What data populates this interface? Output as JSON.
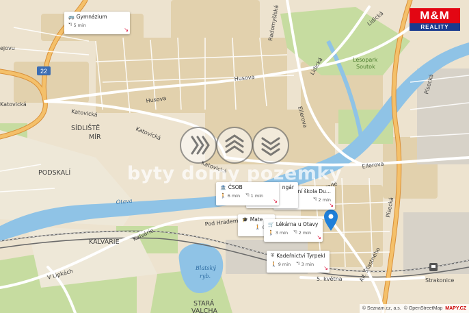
{
  "streets": {
    "radomyslska": "Radomyšlská",
    "lidicka": "Lidická",
    "husova": "Husova",
    "katovicka1": "Katovická",
    "katovicka2": "Katovická",
    "katovicka3": "Katovická",
    "katovicka4": "Katovická",
    "ellerova1": "Ellerova",
    "ellerova2": "Ellerova",
    "piseka1": "Písecká",
    "piseka2": "Písecká",
    "podhradem": "Pod Hradem",
    "kalvarie": "Kalvárie",
    "vlipkach": "V Lipkách",
    "kvetna": "5. května",
    "strasneho": "Alf. Šťastného",
    "brade": "hradě",
    "nejovu": "ejovu"
  },
  "areas": {
    "sidliste": "SÍDLIŠTĚ",
    "mir": "MÍR",
    "podskali": "PODSKALÍ",
    "kalvarie_area": "KALVÁRIE",
    "lesopark": "Lesopark",
    "soutok": "Soutok",
    "stara": "STARÁ",
    "valcha": "VALCHA",
    "blatsky": "Blatský",
    "ryb": "ryb.",
    "otava": "Otava",
    "strakonice": "Strakonice",
    "road_number": "22"
  },
  "pois": [
    {
      "name": "Gymnázium",
      "walk": "",
      "car": "5 min",
      "icon": "bus-icon"
    },
    {
      "name": "ČSOB",
      "walk": "6 min",
      "car": "1 min",
      "icon": "bank-icon"
    },
    {
      "name": "ngár",
      "walk": "",
      "car": "",
      "icon": ""
    },
    {
      "name": "dní škola Du...",
      "walk": "",
      "car": "2 min",
      "icon": ""
    },
    {
      "name": "Mate",
      "walk": "6 m",
      "car": "",
      "icon": "school-icon"
    },
    {
      "name": "Lékárna u Otavy",
      "walk": "3 min",
      "car": "2 min",
      "icon": "cart-icon"
    },
    {
      "name": "Kadeřnictví Tyrpekl",
      "walk": "9 min",
      "car": "3 min",
      "icon": "person-icon"
    }
  ],
  "watermark": "byty domy pozemky",
  "logo": {
    "top": "M&M",
    "bottom": "REALITY"
  },
  "attribution": {
    "seznam": "© Seznam.cz, a.s.",
    "osm": "© OpenStreetMap",
    "mapy": "MAPY.CZ"
  },
  "colors": {
    "water": "#8fc3e6",
    "river": "#7fb6e0",
    "road_major": "#f2b24a",
    "road_minor": "#ffffff",
    "park": "#c6dca0",
    "built": "#e3d4b6",
    "pin": "#1f7fd8"
  }
}
